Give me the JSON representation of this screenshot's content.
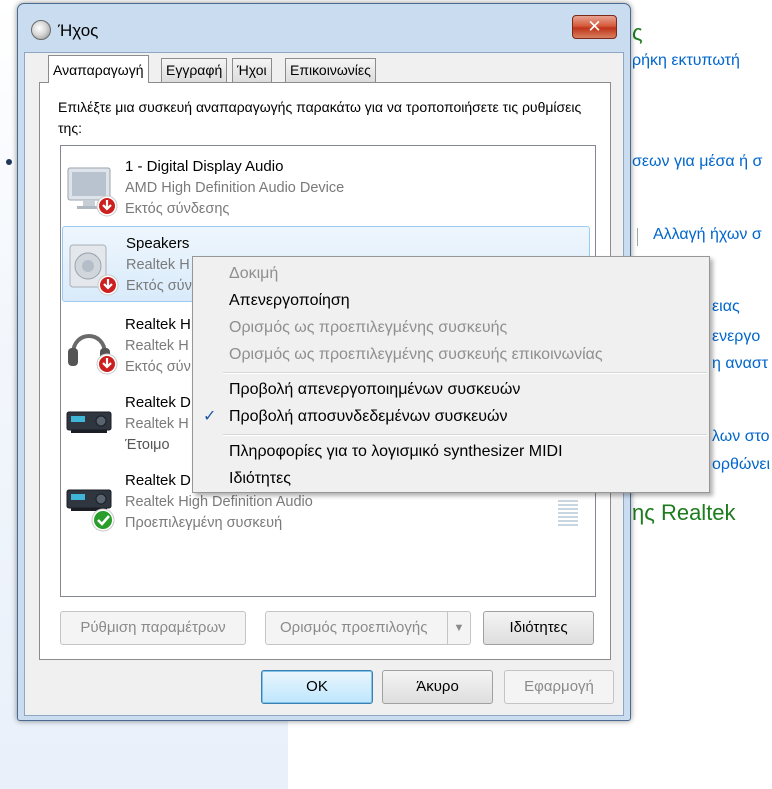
{
  "background": {
    "links": [
      {
        "text": "ς",
        "color": "#1e7b1e"
      },
      {
        "text": "ρήκη εκτυπωτή"
      },
      {
        "text": "σεων για μέσα ή σ"
      },
      {
        "text": "Αλλαγή ήχων σ"
      },
      {
        "text": "ειας"
      },
      {
        "text": "ενεργο"
      },
      {
        "text": "η αναστ"
      },
      {
        "text": "λων στο"
      },
      {
        "text": "ορθώνει"
      }
    ],
    "heading": "ης Realtek"
  },
  "dialog": {
    "title": "Ήχος",
    "close_label": "✕",
    "tabs": [
      "Αναπαραγωγή",
      "Εγγραφή",
      "Ήχοι",
      "Επικοινωνίες"
    ],
    "instruction": "Επιλέξτε μια συσκευή αναπαραγωγής παρακάτω για να τροποποιήσετε τις ρυθμίσεις της:",
    "devices": [
      {
        "name": "1 - Digital Display Audio",
        "sub": "AMD High Definition Audio Device",
        "state": "Εκτός σύνδεσης",
        "icon": "monitor-icon",
        "status": "disconnected"
      },
      {
        "name": "Speakers",
        "sub": "Realtek H",
        "state": "Εκτός σύν",
        "icon": "speaker-icon",
        "status": "disconnected"
      },
      {
        "name": "Realtek H",
        "sub": "Realtek H",
        "state": "Εκτός σύν",
        "icon": "headphones-icon",
        "status": "disconnected"
      },
      {
        "name": "Realtek D",
        "sub": "Realtek H",
        "state": "Έτοιμο",
        "icon": "receiver-icon",
        "status": "ready"
      },
      {
        "name": "Realtek D",
        "sub": "Realtek High Definition Audio",
        "state": "Προεπιλεγμένη συσκευή",
        "icon": "receiver-icon",
        "status": "default"
      }
    ],
    "buttons": {
      "configure": "Ρύθμιση παραμέτρων",
      "set_default": "Ορισμός προεπιλογής",
      "properties": "Ιδιότητες",
      "ok": "OK",
      "cancel": "Άκυρο",
      "apply": "Εφαρμογή"
    }
  },
  "context_menu": {
    "items": [
      {
        "label": "Δοκιμή",
        "enabled": false
      },
      {
        "label": "Απενεργοποίηση",
        "enabled": true
      },
      {
        "label": "Ορισμός ως προεπιλεγμένης συσκευής",
        "enabled": false
      },
      {
        "label": "Ορισμός ως προεπιλεγμένης συσκευής επικοινωνίας",
        "enabled": false
      },
      {
        "label": "Προβολή απενεργοποιημένων συσκευών",
        "enabled": true
      },
      {
        "label": "Προβολή αποσυνδεδεμένων συσκευών",
        "enabled": true,
        "checked": true
      },
      {
        "label": "Πληροφορίες για το λογισμικό synthesizer MIDI",
        "enabled": true
      },
      {
        "label": "Ιδιότητες",
        "enabled": true
      }
    ],
    "check_glyph": "✓"
  },
  "colors": {
    "accent": "#0066cc",
    "close": "#c0341a",
    "ready": "#2a9d2a",
    "disconnected": "#cc1f1f"
  }
}
